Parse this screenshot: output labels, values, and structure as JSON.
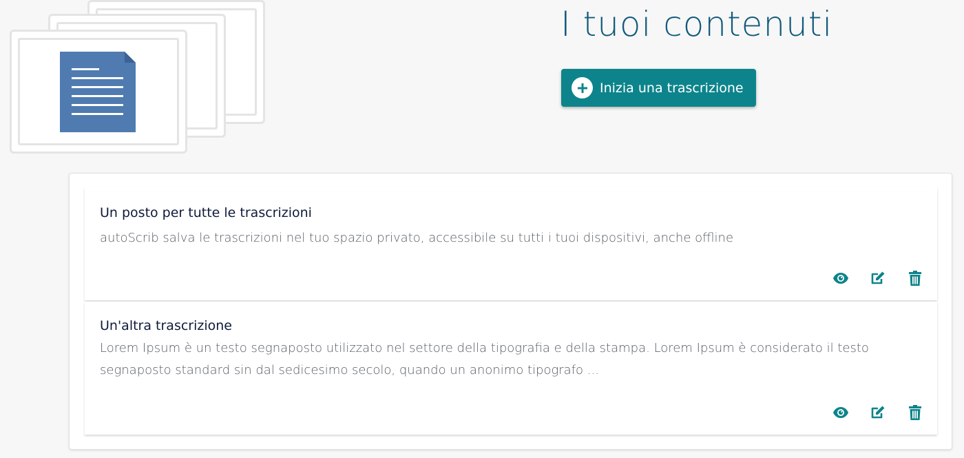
{
  "header": {
    "title": "I tuoi contenuti",
    "start_button_label": "Inizia una trascrizione"
  },
  "illustration": {
    "icon": "document-stack-icon"
  },
  "items": [
    {
      "title": "Un posto per tutte le trascrizioni",
      "description": "autoScrib salva le trascrizioni nel tuo spazio privato, accessibile su tutti i tuoi dispositivi, anche offline",
      "actions": [
        "eye-icon",
        "edit-icon",
        "trash-icon"
      ]
    },
    {
      "title": "Un'altra trascrizione",
      "description": "Lorem Ipsum è un testo segnaposto utilizzato nel settore della tipografia e della stampa. Lorem Ipsum è considerato il testo segnaposto standard sin dal sedicesimo secolo, quando un anonimo tipografo ...",
      "actions": [
        "eye-icon",
        "edit-icon",
        "trash-icon"
      ]
    }
  ],
  "colors": {
    "accent": "#0d848b",
    "title": "#125a7c",
    "document": "#4f7bb0"
  }
}
